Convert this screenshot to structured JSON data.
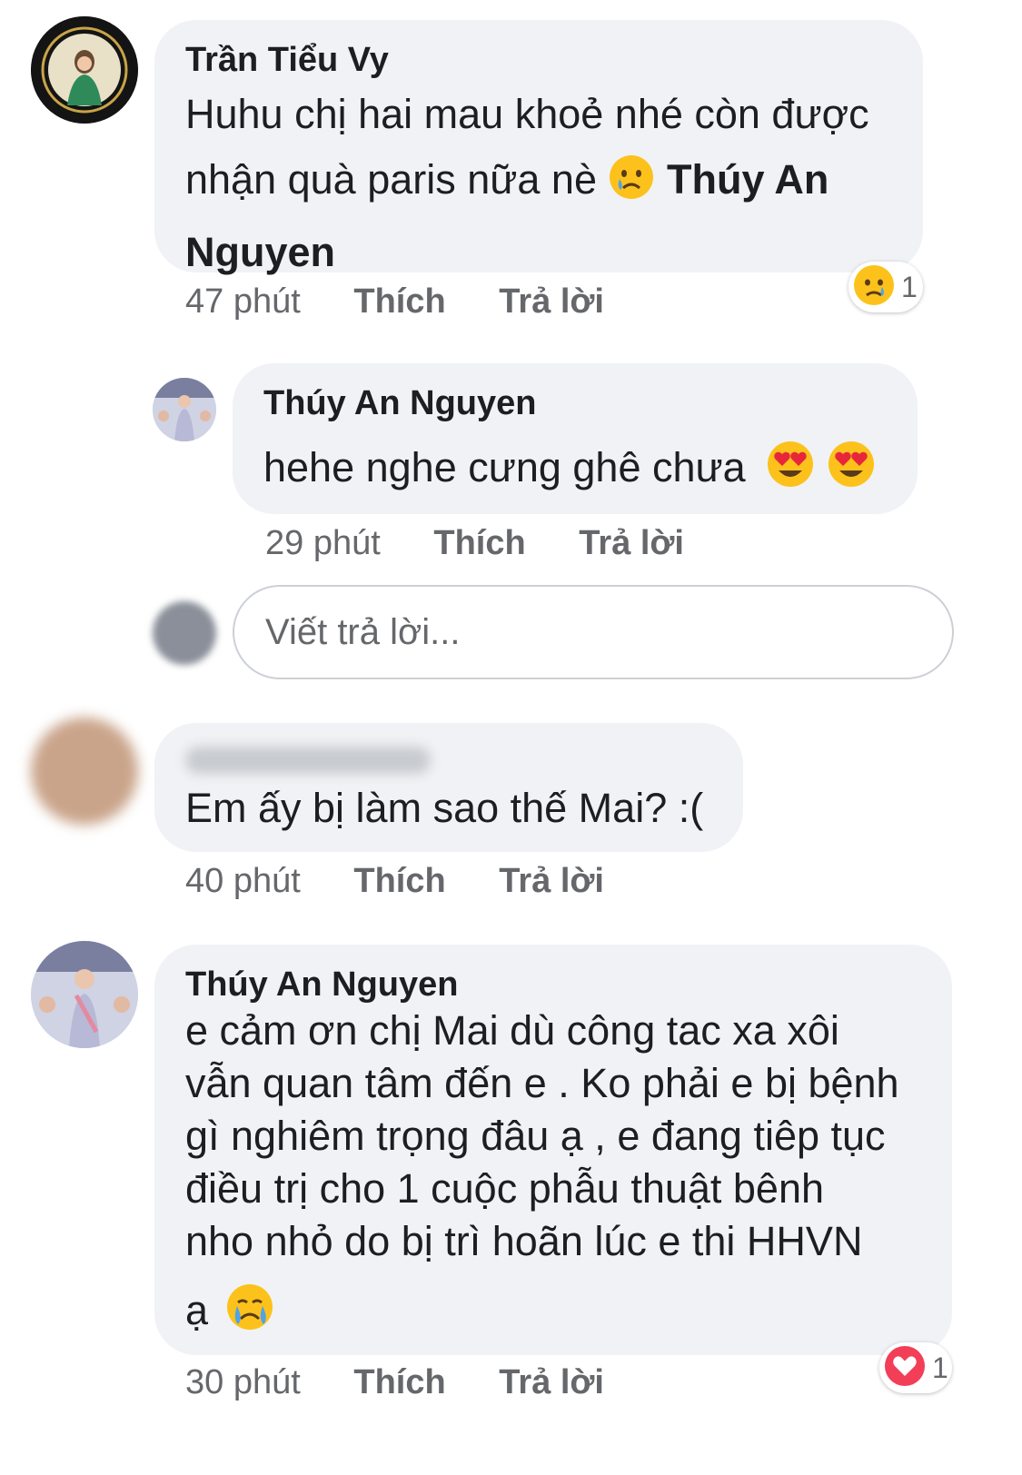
{
  "comments": [
    {
      "author": "Trần Tiểu Vy",
      "text_line1": "Huhu chị hai mau khoẻ nhé còn được",
      "text_line2": "nhận quà paris nữa nè",
      "mention_part1": "Thúy An",
      "mention_part2": "Nguyen",
      "time": "47 phút",
      "like_label": "Thích",
      "reply_label": "Trả lời",
      "reaction": {
        "icon": "sad-reaction-icon",
        "count": "1"
      }
    },
    {
      "author": "Thúy An Nguyen",
      "text": "hehe nghe cưng ghê chưa",
      "time": "29 phút",
      "like_label": "Thích",
      "reply_label": "Trả lời"
    },
    {
      "author": "",
      "text": "Em ấy bị làm sao thế Mai? :(",
      "time": "40 phút",
      "like_label": "Thích",
      "reply_label": "Trả lời"
    },
    {
      "author": "Thúy An Nguyen",
      "lines": [
        "e cảm ơn chị Mai dù công tac xa xôi",
        "vẫn quan tâm đến e . Ko phải e bị bệnh",
        "gì nghiêm trọng đâu ạ , e đang tiêp tục",
        "điều trị cho 1 cuộc phẫu thuật bênh",
        "nho nhỏ do bị trì hoãn lúc e thi HHVN",
        "ạ"
      ],
      "time": "30 phút",
      "like_label": "Thích",
      "reply_label": "Trả lời",
      "reaction": {
        "icon": "heart-reaction-icon",
        "count": "1"
      }
    }
  ],
  "reply_box": {
    "placeholder": "Viết trả lời..."
  },
  "colors": {
    "bubble": "#f0f2f5",
    "meta": "#65676b",
    "text": "#1c1e21",
    "heart": "#f33e58"
  }
}
